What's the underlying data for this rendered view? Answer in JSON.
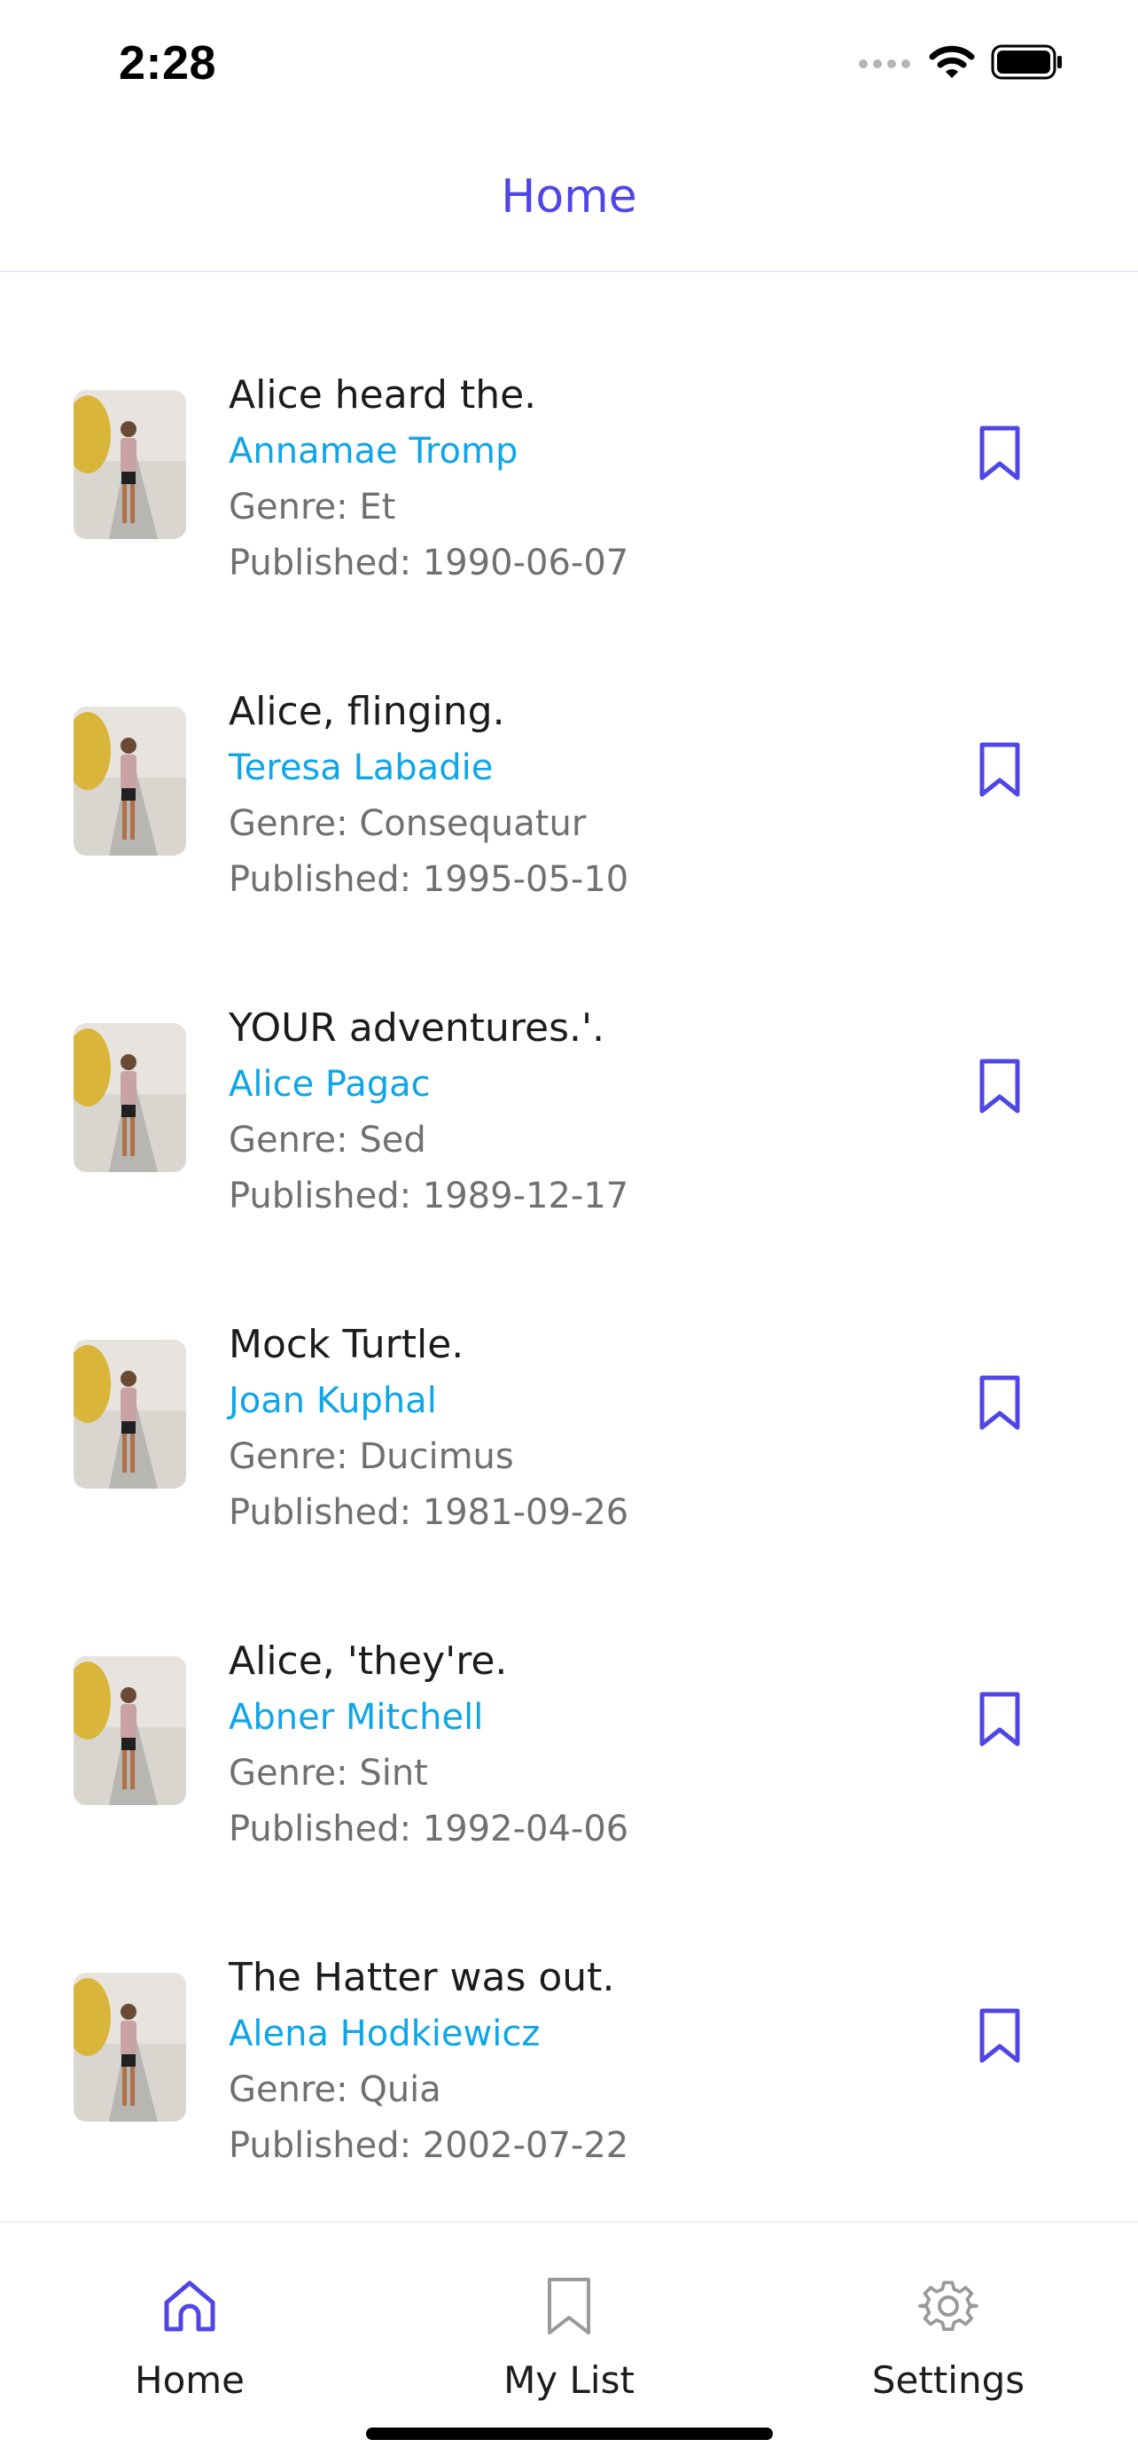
{
  "status_bar": {
    "time": "2:28",
    "icons": [
      "cellular-signal-icon",
      "wifi-icon",
      "battery-icon"
    ]
  },
  "header": {
    "title": "Home"
  },
  "books": [
    {
      "title": "Alice heard the.",
      "author": "Annamae Tromp",
      "genre_label": "Genre: ",
      "genre": "Et",
      "published_label": "Published: ",
      "published": "1990-06-07"
    },
    {
      "title": "Alice, flinging.",
      "author": "Teresa Labadie",
      "genre_label": "Genre: ",
      "genre": "Consequatur",
      "published_label": "Published: ",
      "published": "1995-05-10"
    },
    {
      "title": "YOUR adventures.'.",
      "author": "Alice Pagac",
      "genre_label": "Genre: ",
      "genre": "Sed",
      "published_label": "Published: ",
      "published": "1989-12-17"
    },
    {
      "title": "Mock Turtle.",
      "author": "Joan Kuphal",
      "genre_label": "Genre: ",
      "genre": "Ducimus",
      "published_label": "Published: ",
      "published": "1981-09-26"
    },
    {
      "title": "Alice, 'they're.",
      "author": "Abner Mitchell",
      "genre_label": "Genre: ",
      "genre": "Sint",
      "published_label": "Published: ",
      "published": "1992-04-06"
    },
    {
      "title": "The Hatter was out.",
      "author": "Alena Hodkiewicz",
      "genre_label": "Genre: ",
      "genre": "Quia",
      "published_label": "Published: ",
      "published": "2002-07-22"
    }
  ],
  "tab_bar": {
    "tabs": [
      {
        "label": "Home",
        "icon": "home-icon",
        "active": true
      },
      {
        "label": "My List",
        "icon": "bookmark-icon",
        "active": false
      },
      {
        "label": "Settings",
        "icon": "gear-icon",
        "active": false
      }
    ]
  },
  "colors": {
    "accent": "#5046e5",
    "author": "#0ea5e9",
    "muted_text": "#707070",
    "inactive_icon": "#9a9a9a"
  }
}
